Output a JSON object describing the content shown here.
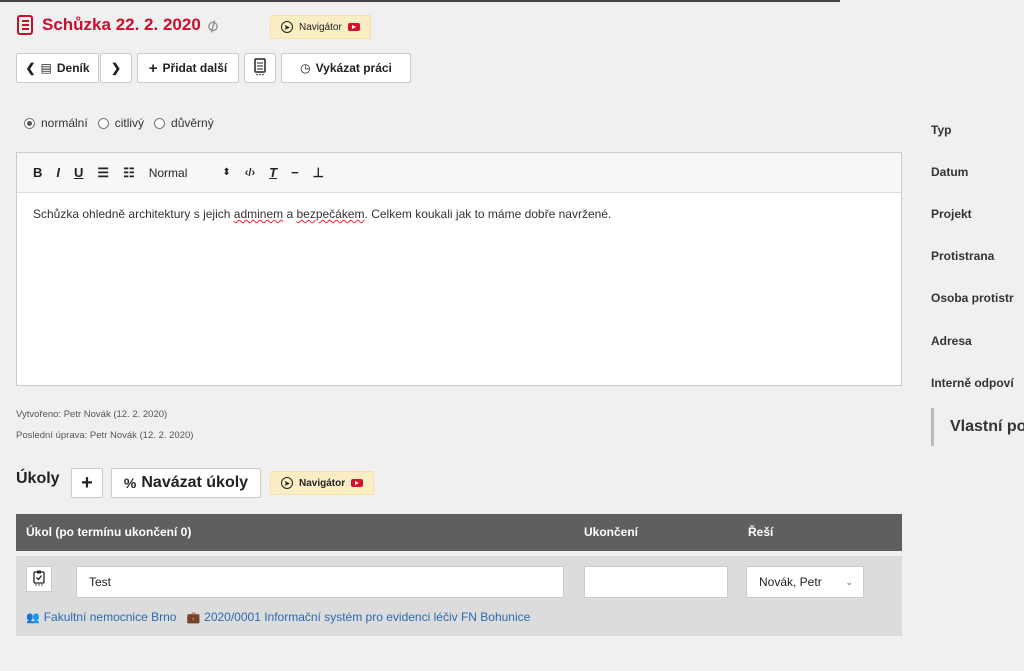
{
  "header": {
    "title": "Schůzka 22. 2. 2020",
    "navigator_label": "Navigátor"
  },
  "toolbar": {
    "diary_label": "Deník",
    "add_more_label": "Přidat další",
    "report_work_label": "Vykázat práci"
  },
  "sensitivity": {
    "options": [
      "normální",
      "citlivý",
      "důvěrný"
    ],
    "selected": "normální"
  },
  "editor": {
    "format_select": "Normal",
    "content_parts": [
      "Schůzka ohledně architektury s jejich ",
      "adminem",
      " a ",
      "bezpečákem",
      ". Celkem koukali jak to máme dobře navržené."
    ]
  },
  "meta": {
    "created": "Vytvořeno: Petr Novák (12. 2. 2020)",
    "modified": "Poslední úprava: Petr Novák (12. 2. 2020)"
  },
  "side_panel": {
    "labels": [
      "Typ",
      "Datum",
      "Projekt",
      "Protistrana",
      "Osoba protistr",
      "Adresa",
      "Interně odpoví"
    ],
    "heading": "Vlastní po"
  },
  "tasks": {
    "title": "Úkoly",
    "link_tasks_label": "Navázat úkoly",
    "navigator_label": "Navigátor",
    "columns": [
      "Úkol (po termínu ukončení 0)",
      "Ukončení",
      "Řeší"
    ],
    "rows": [
      {
        "name": "Test",
        "end": "",
        "assignee": "Novák, Petr",
        "org_link": "Fakultní nemocnice Brno",
        "project_link": "2020/0001 Informační systém pro evidenci léčiv FN Bohunice"
      }
    ]
  },
  "colors": {
    "accent": "#c8102e",
    "table_header": "#5f5f5f",
    "link": "#2a6ab0",
    "navigator_bg": "#fbeec5"
  }
}
